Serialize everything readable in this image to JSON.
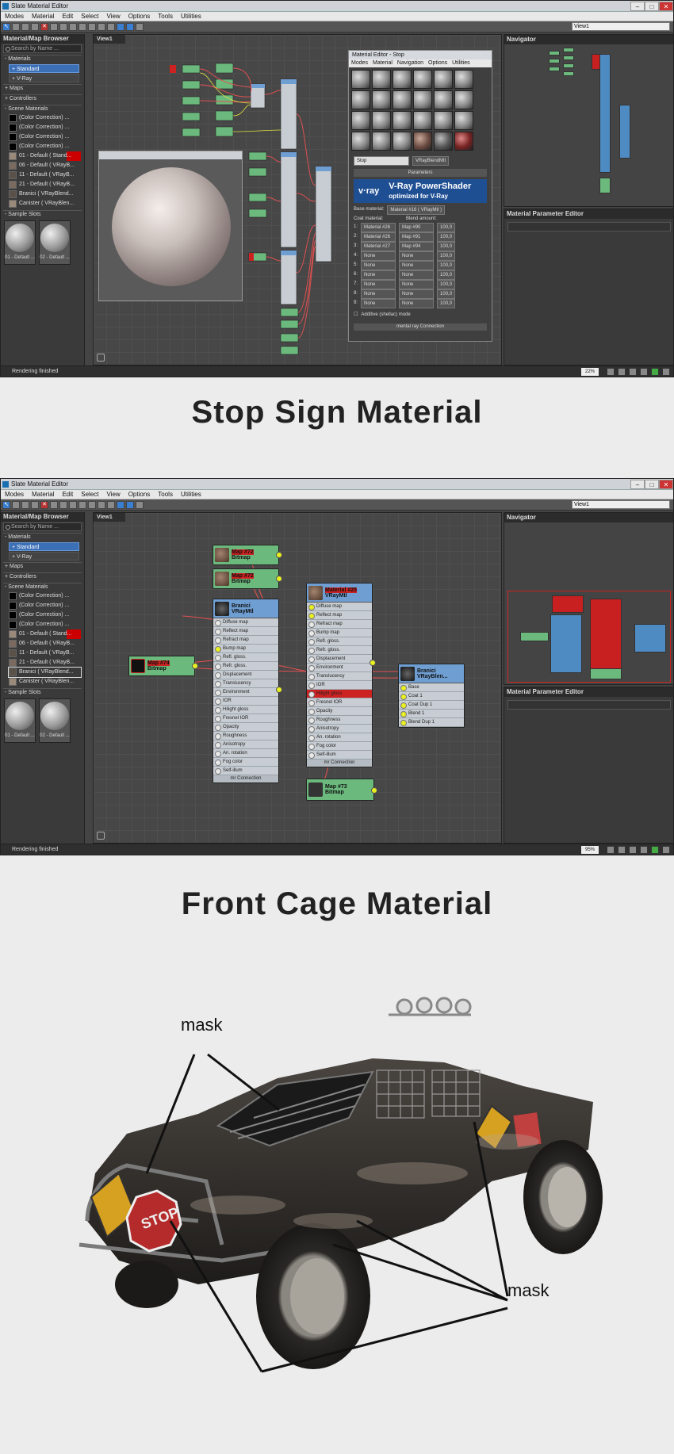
{
  "window": {
    "title": "Slate Material Editor",
    "menus": [
      "Modes",
      "Material",
      "Edit",
      "Select",
      "View",
      "Options",
      "Tools",
      "Utilities"
    ],
    "view_selector": "View1",
    "view_tab": "View1",
    "browser_title": "Material/Map Browser",
    "search_placeholder": "Search by Name ...",
    "sections": {
      "materials": "- Materials",
      "maps": "+ Maps",
      "controllers": "+ Controllers",
      "scene": "- Scene Materials",
      "slots": "- Sample Slots"
    },
    "material_items": [
      "+ Standard",
      "+ V-Ray"
    ],
    "scene_materials_1": [
      "(Color Correction) ...",
      "(Color Correction) ...",
      "(Color Correction) ...",
      "(Color Correction) ...",
      "01 - Default ( Stand...",
      "06 - Default ( VRayB...",
      "11 - Default ( VRayB...",
      "21 - Default ( VRayB...",
      "Branici ( VRayBlend...",
      "Canister ( VRayBlen..."
    ],
    "scene_materials_2": [
      "(Color Correction) ...",
      "(Color Correction) ...",
      "(Color Correction) ...",
      "(Color Correction) ...",
      "01 - Default ( Stand...",
      "06 - Default ( VRayB...",
      "11 - Default ( VRayB...",
      "21 - Default ( VRayB...",
      "Branici ( VRayBlend...",
      "Canister ( VRayBlen..."
    ],
    "slot_labels": [
      "01 - Default ...",
      "02 - Default ..."
    ],
    "navigator": "Navigator",
    "param_editor": "Material Parameter Editor",
    "status": "Rendering finished",
    "zoom_1": "22%",
    "zoom_2": "95%"
  },
  "captions": {
    "first": "Stop Sign Material",
    "second": "Front Cage Material"
  },
  "material_editor": {
    "title": "Material Editor - Stop",
    "menus": [
      "Modes",
      "Material",
      "Navigation",
      "Options",
      "Utilities"
    ],
    "name": "Stop",
    "type": "VRayBlendMtl",
    "rollout": "Parameters",
    "vray_logo": "v·ray",
    "vray_title": "V-Ray PowerShader",
    "vray_sub": "optimized for V-Ray",
    "base_label": "Base material:",
    "base_value": "Material #16 ( VRayMtl )",
    "coat_header": "Coat material:",
    "blend_header": "Blend amount:",
    "rows": [
      {
        "n": "1:",
        "coat": "Material #26",
        "map": "Map #90",
        "amt": "100,0"
      },
      {
        "n": "2:",
        "coat": "Material #26",
        "map": "Map #91",
        "amt": "100,0"
      },
      {
        "n": "3:",
        "coat": "Material #27",
        "map": "Map #94",
        "amt": "100,0"
      },
      {
        "n": "4:",
        "coat": "None",
        "map": "None",
        "amt": "100,0"
      },
      {
        "n": "5:",
        "coat": "None",
        "map": "None",
        "amt": "100,0"
      },
      {
        "n": "6:",
        "coat": "None",
        "map": "None",
        "amt": "100,0"
      },
      {
        "n": "7:",
        "coat": "None",
        "map": "None",
        "amt": "100,0"
      },
      {
        "n": "8:",
        "coat": "None",
        "map": "None",
        "amt": "100,0"
      },
      {
        "n": "9:",
        "coat": "None",
        "map": "None",
        "amt": "100,0"
      }
    ],
    "additive": "Additive (shellac) mode",
    "mental_ray": "mental ray Connection"
  },
  "nodes2": {
    "map72a": {
      "t1": "Map #72",
      "t2": "Bitmap"
    },
    "map72b": {
      "t1": "Map #72",
      "t2": "Bitmap"
    },
    "map74": {
      "t1": "Map #74",
      "t2": "Bitmap"
    },
    "map73": {
      "t1": "Map #73",
      "t2": "Bitmap"
    },
    "branici": {
      "t1": "Branici",
      "t2": "VRayMtl",
      "rows": [
        "Diffuse map",
        "Reflect map",
        "Refract map",
        "Bump map",
        "Refl. gloss.",
        "Refr. gloss.",
        "Displacement",
        "Translucency",
        "Environment",
        "IOR",
        "Hilight gloss",
        "Fresnel IOR",
        "Opacity",
        "Roughness",
        "Anisotropy",
        "An. rotation",
        "Fog color",
        "Self-illum"
      ],
      "foot": "mr Connection"
    },
    "mat25": {
      "t1": "Material #25",
      "t2": "VRayMtl",
      "rows": [
        "Diffuse map",
        "Reflect map",
        "Refract map",
        "Bump map",
        "Refl. gloss.",
        "Refr. gloss.",
        "Displacement",
        "Environment",
        "Translucency",
        "IOR",
        "Hilight gloss",
        "Fresnel IOR",
        "Opacity",
        "Roughness",
        "Anisotropy",
        "An. rotation",
        "Fog color",
        "Self-illum"
      ],
      "foot": "mr Connection"
    },
    "blend": {
      "t1": "Branici",
      "t2": "VRayBlen...",
      "rows": [
        "Base",
        "Coat 1",
        "Coat Dup 1",
        "Blend 1",
        "Blend Dup 1"
      ]
    }
  },
  "annotations": {
    "mask_top": "mask",
    "mask_bottom": "mask"
  },
  "colors": {
    "accent": "#3b6fb6",
    "node_blue": "#6f9ed2",
    "node_green": "#6cb97d",
    "wire": "#e05050",
    "port": "#e8f020"
  }
}
